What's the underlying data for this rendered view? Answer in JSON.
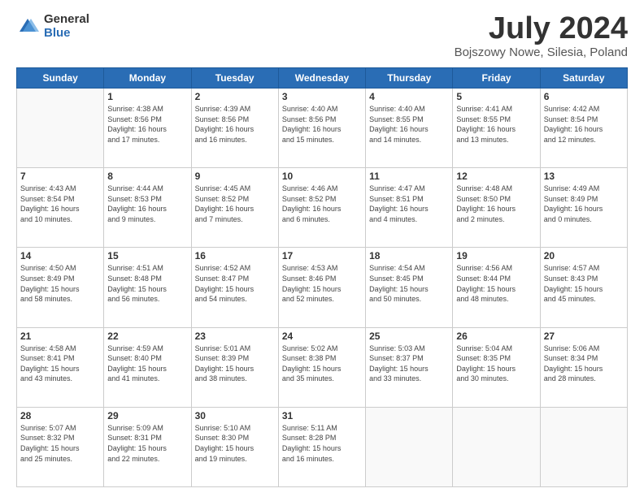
{
  "logo": {
    "general": "General",
    "blue": "Blue"
  },
  "header": {
    "month": "July 2024",
    "location": "Bojszowy Nowe, Silesia, Poland"
  },
  "weekdays": [
    "Sunday",
    "Monday",
    "Tuesday",
    "Wednesday",
    "Thursday",
    "Friday",
    "Saturday"
  ],
  "weeks": [
    [
      {
        "day": "",
        "info": ""
      },
      {
        "day": "1",
        "info": "Sunrise: 4:38 AM\nSunset: 8:56 PM\nDaylight: 16 hours\nand 17 minutes."
      },
      {
        "day": "2",
        "info": "Sunrise: 4:39 AM\nSunset: 8:56 PM\nDaylight: 16 hours\nand 16 minutes."
      },
      {
        "day": "3",
        "info": "Sunrise: 4:40 AM\nSunset: 8:56 PM\nDaylight: 16 hours\nand 15 minutes."
      },
      {
        "day": "4",
        "info": "Sunrise: 4:40 AM\nSunset: 8:55 PM\nDaylight: 16 hours\nand 14 minutes."
      },
      {
        "day": "5",
        "info": "Sunrise: 4:41 AM\nSunset: 8:55 PM\nDaylight: 16 hours\nand 13 minutes."
      },
      {
        "day": "6",
        "info": "Sunrise: 4:42 AM\nSunset: 8:54 PM\nDaylight: 16 hours\nand 12 minutes."
      }
    ],
    [
      {
        "day": "7",
        "info": "Sunrise: 4:43 AM\nSunset: 8:54 PM\nDaylight: 16 hours\nand 10 minutes."
      },
      {
        "day": "8",
        "info": "Sunrise: 4:44 AM\nSunset: 8:53 PM\nDaylight: 16 hours\nand 9 minutes."
      },
      {
        "day": "9",
        "info": "Sunrise: 4:45 AM\nSunset: 8:52 PM\nDaylight: 16 hours\nand 7 minutes."
      },
      {
        "day": "10",
        "info": "Sunrise: 4:46 AM\nSunset: 8:52 PM\nDaylight: 16 hours\nand 6 minutes."
      },
      {
        "day": "11",
        "info": "Sunrise: 4:47 AM\nSunset: 8:51 PM\nDaylight: 16 hours\nand 4 minutes."
      },
      {
        "day": "12",
        "info": "Sunrise: 4:48 AM\nSunset: 8:50 PM\nDaylight: 16 hours\nand 2 minutes."
      },
      {
        "day": "13",
        "info": "Sunrise: 4:49 AM\nSunset: 8:49 PM\nDaylight: 16 hours\nand 0 minutes."
      }
    ],
    [
      {
        "day": "14",
        "info": "Sunrise: 4:50 AM\nSunset: 8:49 PM\nDaylight: 15 hours\nand 58 minutes."
      },
      {
        "day": "15",
        "info": "Sunrise: 4:51 AM\nSunset: 8:48 PM\nDaylight: 15 hours\nand 56 minutes."
      },
      {
        "day": "16",
        "info": "Sunrise: 4:52 AM\nSunset: 8:47 PM\nDaylight: 15 hours\nand 54 minutes."
      },
      {
        "day": "17",
        "info": "Sunrise: 4:53 AM\nSunset: 8:46 PM\nDaylight: 15 hours\nand 52 minutes."
      },
      {
        "day": "18",
        "info": "Sunrise: 4:54 AM\nSunset: 8:45 PM\nDaylight: 15 hours\nand 50 minutes."
      },
      {
        "day": "19",
        "info": "Sunrise: 4:56 AM\nSunset: 8:44 PM\nDaylight: 15 hours\nand 48 minutes."
      },
      {
        "day": "20",
        "info": "Sunrise: 4:57 AM\nSunset: 8:43 PM\nDaylight: 15 hours\nand 45 minutes."
      }
    ],
    [
      {
        "day": "21",
        "info": "Sunrise: 4:58 AM\nSunset: 8:41 PM\nDaylight: 15 hours\nand 43 minutes."
      },
      {
        "day": "22",
        "info": "Sunrise: 4:59 AM\nSunset: 8:40 PM\nDaylight: 15 hours\nand 41 minutes."
      },
      {
        "day": "23",
        "info": "Sunrise: 5:01 AM\nSunset: 8:39 PM\nDaylight: 15 hours\nand 38 minutes."
      },
      {
        "day": "24",
        "info": "Sunrise: 5:02 AM\nSunset: 8:38 PM\nDaylight: 15 hours\nand 35 minutes."
      },
      {
        "day": "25",
        "info": "Sunrise: 5:03 AM\nSunset: 8:37 PM\nDaylight: 15 hours\nand 33 minutes."
      },
      {
        "day": "26",
        "info": "Sunrise: 5:04 AM\nSunset: 8:35 PM\nDaylight: 15 hours\nand 30 minutes."
      },
      {
        "day": "27",
        "info": "Sunrise: 5:06 AM\nSunset: 8:34 PM\nDaylight: 15 hours\nand 28 minutes."
      }
    ],
    [
      {
        "day": "28",
        "info": "Sunrise: 5:07 AM\nSunset: 8:32 PM\nDaylight: 15 hours\nand 25 minutes."
      },
      {
        "day": "29",
        "info": "Sunrise: 5:09 AM\nSunset: 8:31 PM\nDaylight: 15 hours\nand 22 minutes."
      },
      {
        "day": "30",
        "info": "Sunrise: 5:10 AM\nSunset: 8:30 PM\nDaylight: 15 hours\nand 19 minutes."
      },
      {
        "day": "31",
        "info": "Sunrise: 5:11 AM\nSunset: 8:28 PM\nDaylight: 15 hours\nand 16 minutes."
      },
      {
        "day": "",
        "info": ""
      },
      {
        "day": "",
        "info": ""
      },
      {
        "day": "",
        "info": ""
      }
    ]
  ]
}
